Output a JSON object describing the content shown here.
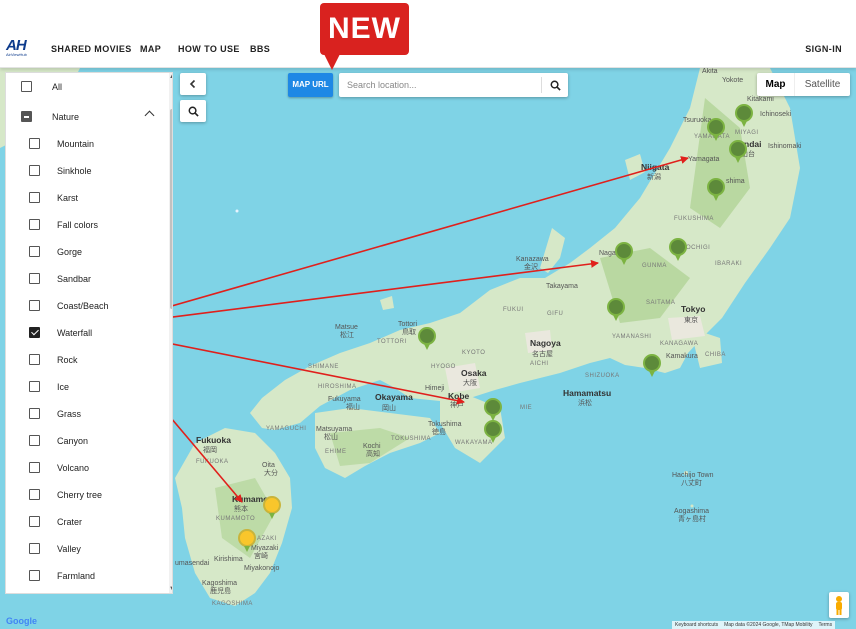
{
  "header": {
    "logo_mark": "AH",
    "logo_sub": "AirViewHub",
    "nav": [
      "SHARED MOVIES",
      "MAP",
      "HOW TO USE",
      "BBS"
    ],
    "signin": "SIGN-IN",
    "new_badge": "NEW"
  },
  "toolbar": {
    "map_url_label": "MAP URL",
    "search_placeholder": "Search location...",
    "map_types": [
      "Map",
      "Satellite"
    ],
    "active_map_type": "Map"
  },
  "filter": {
    "all_label": "All",
    "group_label": "Nature",
    "items": [
      {
        "label": "Mountain",
        "checked": false
      },
      {
        "label": "Sinkhole",
        "checked": false
      },
      {
        "label": "Karst",
        "checked": false
      },
      {
        "label": "Fall colors",
        "checked": false
      },
      {
        "label": "Gorge",
        "checked": false
      },
      {
        "label": "Sandbar",
        "checked": false
      },
      {
        "label": "Coast/Beach",
        "checked": false
      },
      {
        "label": "Waterfall",
        "checked": true
      },
      {
        "label": "Rock",
        "checked": false
      },
      {
        "label": "Ice",
        "checked": false
      },
      {
        "label": "Grass",
        "checked": false
      },
      {
        "label": "Canyon",
        "checked": false
      },
      {
        "label": "Volcano",
        "checked": false
      },
      {
        "label": "Cherry tree",
        "checked": false
      },
      {
        "label": "Crater",
        "checked": false
      },
      {
        "label": "Valley",
        "checked": false
      },
      {
        "label": "Farmland",
        "checked": false
      }
    ]
  },
  "map_labels": {
    "akita": "Akita",
    "yokote": "Yokote",
    "kitakami": "Kitakami",
    "ichinoseki": "Ichinoseki",
    "tsuruoka": "Tsuruoka",
    "yamagata_pref": "YAMAGATA",
    "miyagi": "MIYAGI",
    "sendai": "ndai",
    "sendai_jp": "山台",
    "ishinomaki": "Ishinomaki",
    "yamagata": "Yamagata",
    "niigata": "Niigata",
    "niigata_jp": "新潟",
    "fukushima": "shima",
    "fukushima_pref": "FUKUSHIMA",
    "kanazawa": "Kanazawa",
    "kanazawa_jp": "金沢",
    "nagano": "Nagano",
    "gunma": "GUNMA",
    "tochigi": "OCHIGI",
    "ibaraki": "IBARAKI",
    "takayama": "Takayama",
    "saitama": "SAITAMA",
    "tokyo": "Tokyo",
    "tokyo_jp": "東京",
    "yamanashi": "YAMANASHI",
    "kanagawa": "KANAGAWA",
    "chiba": "CHIBA",
    "kamakura": "Kamakura",
    "fukui": "FUKUI",
    "gifu": "GIFU",
    "matsue": "Matsue",
    "matsue_jp": "松江",
    "tottori": "Tottori",
    "tottori_jp": "鳥取",
    "tottori_pref": "TOTTORI",
    "kyoto": "KYOTO",
    "nagoya": "Nagoya",
    "nagoya_jp": "名古屋",
    "aichi": "AICHI",
    "shizuoka": "SHIZUOKA",
    "shimane": "SHIMANE",
    "okayama": "Okayama",
    "okayama_jp": "岡山",
    "hyogo": "HYOGO",
    "osaka": "Osaka",
    "osaka_jp": "大阪",
    "kobe": "Kobe",
    "kobe_jp": "神戸",
    "himeji": "Himeji",
    "hiroshima_pref": "HIROSHIMA",
    "fukuyama": "Fukuyama",
    "fukuyama_jp": "福山",
    "mie": "MIE",
    "hamamatsu": "Hamamatsu",
    "hamamatsu_jp": "浜松",
    "yamaguchi": "YAMAGUCHI",
    "matsuyama": "Matsuyama",
    "matsuyama_jp": "松山",
    "kochi": "Kochi",
    "kochi_jp": "高知",
    "tokushima": "Tokushima",
    "tokushima_jp": "徳島",
    "ehime": "EHIME",
    "tokushima_pref": "TOKUSHIMA",
    "wakayama": "WAKAYAMA",
    "fukuoka": "Fukuoka",
    "fukuoka_jp": "福岡",
    "fukuoka_pref": "FUKUOKA",
    "oita": "Oita",
    "oita_jp": "大分",
    "kumamoto": "Kumamo",
    "kumamoto_jp": "熊本",
    "kumamoto_pref": "KUMAMOTO",
    "miyazaki_pref": "AZAKI",
    "miyazaki": "Miyazaki",
    "miyazaki_jp": "宮崎",
    "kirishima": "Kirishima",
    "umasendai": "umasendai",
    "miyakonojo": "Miyakonojo",
    "kagoshima": "Kagoshima",
    "kagoshima_jp": "鹿児島",
    "kagoshima_pref": "KAGOSHIMA",
    "hachijo": "Hachijo Town",
    "hachijo_jp": "八丈町",
    "aogashima": "Aogashima",
    "aogashima_jp": "青ヶ島村"
  },
  "map_footer": {
    "google": "Google",
    "shortcuts": "Keyboard shortcuts",
    "map_data": "Map data ©2024 Google, TMap Mobility",
    "terms": "Terms"
  },
  "colors": {
    "water": "#7fd3e6",
    "land": "#d6e8c8",
    "new_badge": "#d9221f",
    "map_url": "#1e88e5",
    "arrow": "#e0201c"
  }
}
